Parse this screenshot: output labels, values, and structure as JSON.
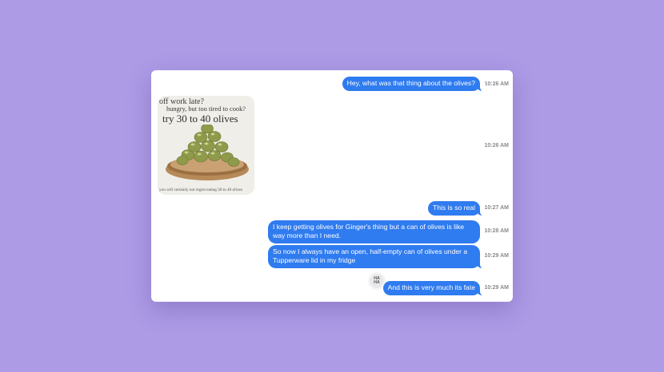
{
  "messages": [
    {
      "text": "Hey, what was that thing about the olives?",
      "time": "10:26 AM"
    },
    {
      "type": "image",
      "time": "10:26 AM",
      "image_text": {
        "line1": "off work late?",
        "line2": "hungry, but too tired to cook?",
        "line3": "try 30 to 40 olives",
        "footer": "you will certainly not regret eating 30 to 40 olives"
      }
    },
    {
      "text": "This is so real",
      "time": "10:27 AM"
    },
    {
      "text": "I keep getting olives for Ginger's thing but a can of olives is like way more than I need.",
      "time": "10:28 AM"
    },
    {
      "text": "So now I always have an open, half-empty can of olives under a Tupperware lid in my fridge",
      "time": "10:29 AM"
    },
    {
      "text": "And this is very much its fate",
      "time": "10:29 AM",
      "reaction": {
        "icon": "haha-reaction-icon",
        "line1": "HA",
        "line2": "HA"
      }
    }
  ],
  "colors": {
    "background": "#ad9be6",
    "bubble": "#2f7bf0"
  }
}
